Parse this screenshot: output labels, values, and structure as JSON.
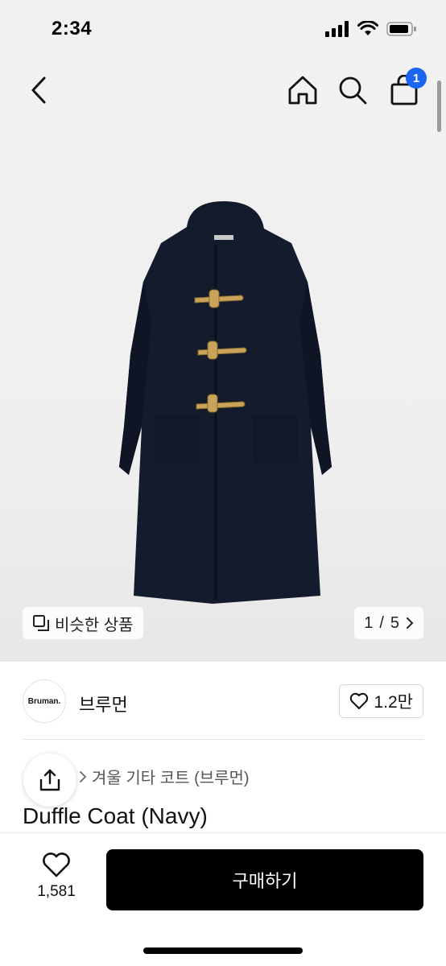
{
  "status_bar": {
    "time": "2:34"
  },
  "header": {
    "cart_count": "1"
  },
  "gallery": {
    "similar_label": "비슷한 상품",
    "page_current": "1",
    "page_separator": "/",
    "page_total": "5"
  },
  "brand": {
    "logo_text": "Bruman.",
    "name": "브루먼",
    "likes": "1.2만"
  },
  "product": {
    "category": "겨울 기타 코트 (브루먼)",
    "title": "Duffle Coat (Navy)",
    "like_count": "1,581",
    "buy_label": "구매하기"
  },
  "colors": {
    "accent": "#1c64f2",
    "buy_button": "#000000",
    "background": "#f1f1f1"
  }
}
